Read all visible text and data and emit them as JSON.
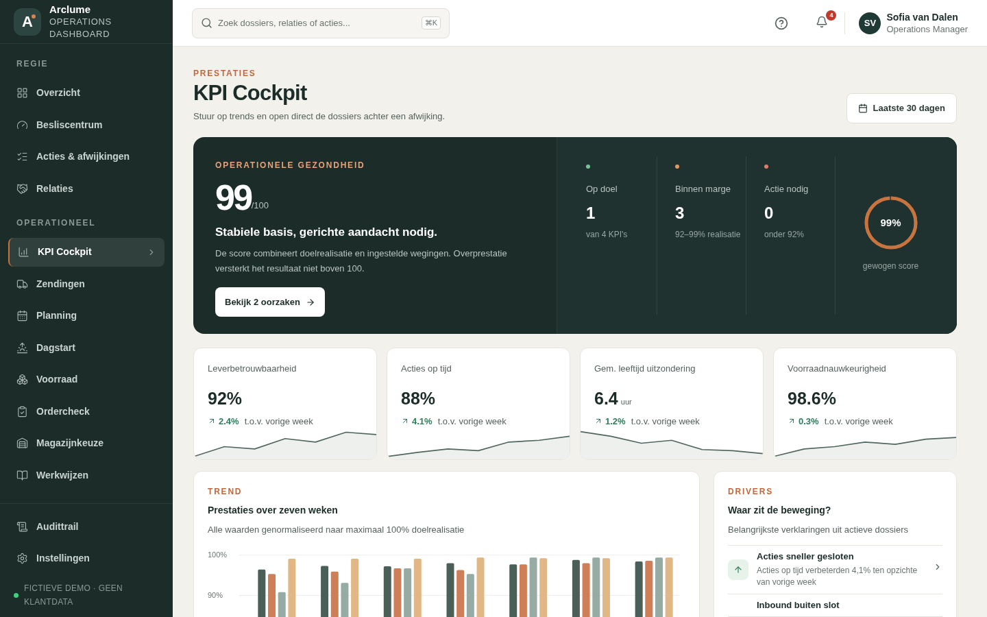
{
  "brand": {
    "logo": "A",
    "name": "Arclume",
    "subtitle": "OPERATIONS DASHBOARD"
  },
  "sidebar": {
    "sections": [
      {
        "title": "REGIE",
        "items": [
          {
            "label": "Overzicht",
            "selected": false
          },
          {
            "label": "Besliscentrum",
            "selected": false
          },
          {
            "label": "Acties & afwijkingen",
            "selected": false
          },
          {
            "label": "Relaties",
            "selected": false
          }
        ]
      },
      {
        "title": "OPERATIONEEL",
        "items": [
          {
            "label": "KPI Cockpit",
            "selected": true
          },
          {
            "label": "Zendingen",
            "selected": false
          },
          {
            "label": "Planning",
            "selected": false
          },
          {
            "label": "Dagstart",
            "selected": false
          },
          {
            "label": "Voorraad",
            "selected": false
          },
          {
            "label": "Ordercheck",
            "selected": false
          },
          {
            "label": "Magazijnkeuze",
            "selected": false
          },
          {
            "label": "Werkwijzen",
            "selected": false
          }
        ]
      }
    ],
    "footer_items": [
      {
        "label": "Audittrail",
        "selected": false
      },
      {
        "label": "Instellingen",
        "selected": false
      }
    ],
    "notice": "FICTIEVE DEMO · GEEN KLANTDATA"
  },
  "topbar": {
    "search": {
      "placeholder": "Zoek dossiers, relaties of acties...",
      "shortcut": "⌘K"
    },
    "notifications": "4",
    "user": {
      "initials": "SV",
      "name": "Sofia van Dalen",
      "role": "Operations Manager"
    }
  },
  "page": {
    "eyebrow": "PRESTATIES",
    "title": "KPI Cockpit",
    "subtitle": "Stuur op trends en open direct de dossiers achter een afwijking.",
    "period_button": "Laatste 30 dagen"
  },
  "health": {
    "eyebrow": "OPERATIONELE GEZONDHEID",
    "score": "99",
    "max": "/100",
    "headline": "Stabiele basis, gerichte aandacht nodig.",
    "text": "De score combineert doelrealisatie en ingestelde wegingen. Overprestatie versterkt het resultaat niet boven 100.",
    "button": "Bekijk 2 oorzaken",
    "stats": [
      {
        "label": "Op doel",
        "value": "1",
        "note": "van 4 KPI's",
        "color": "#7cc49c"
      },
      {
        "label": "Binnen marge",
        "value": "3",
        "note": "92–99% realisatie",
        "color": "#e09a66"
      },
      {
        "label": "Actie nodig",
        "value": "0",
        "note": "onder 92%",
        "color": "#e07b70"
      }
    ],
    "gauge": {
      "value": "99%",
      "level": 0.99,
      "label": "gewogen score"
    }
  },
  "kpis": [
    {
      "label": "Leverbetrouwbaarheid",
      "value": "92%",
      "change": "2.4%",
      "note": "t.o.v. vorige week"
    },
    {
      "label": "Acties op tijd",
      "value": "88%",
      "change": "4.1%",
      "note": "t.o.v. vorige week"
    },
    {
      "label": "Gem. leeftijd uitzondering",
      "value": "6.4",
      "unit": "uur",
      "change": "1.2%",
      "note": "t.o.v. vorige week"
    },
    {
      "label": "Voorraadnauwkeurigheid",
      "value": "98.6%",
      "change": "0.3%",
      "note": "t.o.v. vorige week"
    }
  ],
  "trend": {
    "eyebrow": "TREND",
    "title": "Prestaties over zeven weken",
    "subtitle": "Alle waarden genormaliseerd naar maximaal 100% doelrealisatie",
    "chart_data": {
      "type": "bar",
      "ylim": [
        80,
        100
      ],
      "yticks": [
        {
          "value": 100,
          "label": "100%"
        },
        {
          "value": 90,
          "label": "90%"
        }
      ],
      "series": [
        {
          "color": "#4a5f58",
          "values": [
            96.4,
            97.3,
            97.2,
            98.0,
            97.7,
            98.8,
            98.4
          ]
        },
        {
          "color": "#cf7f57",
          "values": [
            95.3,
            95.9,
            96.7,
            96.3,
            97.7,
            98.0,
            98.6
          ]
        },
        {
          "color": "#95aba3",
          "values": [
            90.8,
            93.1,
            96.7,
            95.3,
            99.4,
            99.4,
            99.4
          ]
        },
        {
          "color": "#e0b785",
          "values": [
            99.1,
            99.1,
            99.1,
            99.4,
            99.2,
            99.2,
            99.4
          ]
        }
      ]
    }
  },
  "drivers": {
    "eyebrow": "DRIVERS",
    "title": "Waar zit de beweging?",
    "subtitle": "Belangrijkste verklaringen uit actieve dossiers",
    "items": [
      {
        "kind": "up",
        "title": "Acties sneller gesloten",
        "text": "Acties op tijd verbeterden 4,1% ten opzichte van vorige week"
      },
      {
        "kind": "plain",
        "title": "Inbound buiten slot"
      }
    ]
  }
}
